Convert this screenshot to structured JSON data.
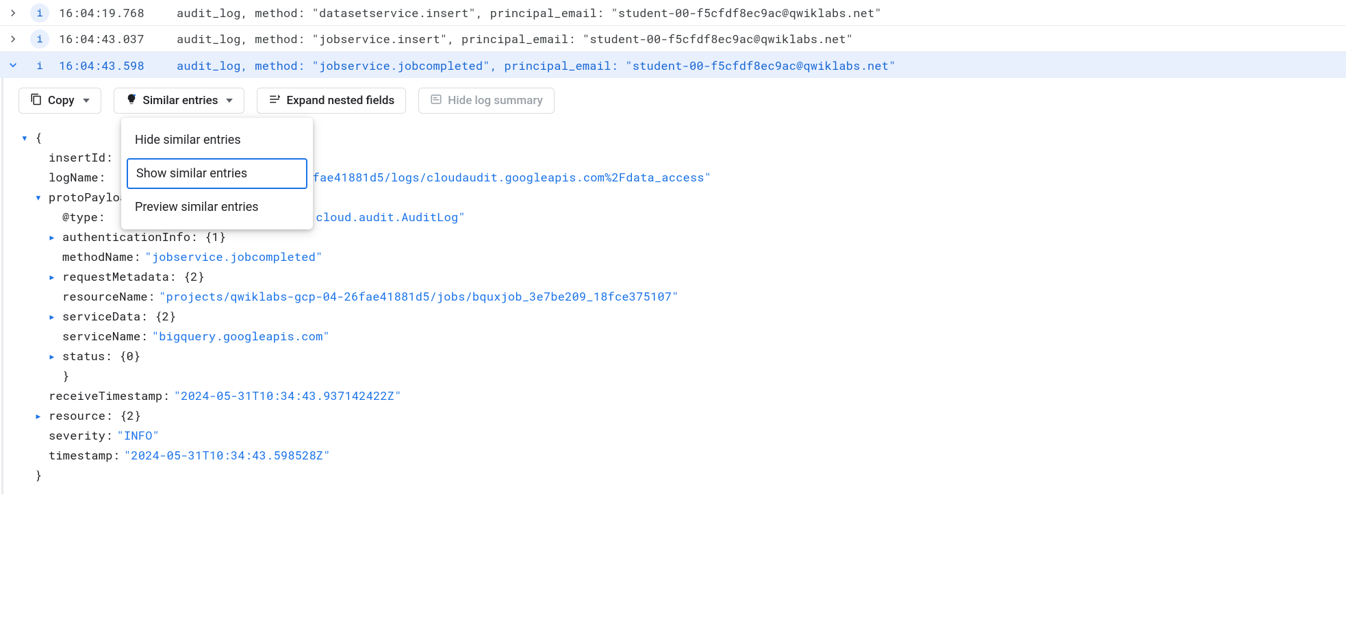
{
  "rows": [
    {
      "ts": "16:04:19.768",
      "summary_prefix": "audit_log, method: ",
      "method": "\"datasetservice.insert\"",
      "summary_mid": ", principal_email: ",
      "email": "\"student-00-f5cfdf8ec9ac@qwiklabs.net\""
    },
    {
      "ts": "16:04:43.037",
      "summary_prefix": "audit_log, method: ",
      "method": "\"jobservice.insert\"",
      "summary_mid": ", principal_email: ",
      "email": "\"student-00-f5cfdf8ec9ac@qwiklabs.net\""
    },
    {
      "ts": "16:04:43.598",
      "summary_prefix": "audit_log, method: ",
      "method": "\"jobservice.jobcompleted\"",
      "summary_mid": ", principal_email: ",
      "email": "\"student-00-f5cfdf8ec9ac@qwiklabs.net\""
    }
  ],
  "toolbar": {
    "copy": "Copy",
    "similar": "Similar entries",
    "expand": "Expand nested fields",
    "hide_summary": "Hide log summary"
  },
  "menu": {
    "hide": "Hide similar entries",
    "show": "Show similar entries",
    "preview": "Preview similar entries"
  },
  "entry": {
    "insertId_key": "insertId:",
    "logName_key": "logName:",
    "logName_tail": "6fae41881d5/logs/cloudaudit.googleapis.com%2Fdata_access\"",
    "protoPayload_key": "protoPayload:",
    "atType_key": "@type:",
    "atType_tail": "cloud.audit.AuditLog\"",
    "authInfo_label": "authenticationInfo: {1}",
    "methodName_key": "methodName:",
    "methodName_val": "\"jobservice.jobcompleted\"",
    "reqMeta_label": "requestMetadata: {2}",
    "resourceName_key": "resourceName:",
    "resourceName_val": "\"projects/qwiklabs-gcp-04-26fae41881d5/jobs/bquxjob_3e7be209_18fce375107\"",
    "serviceData_label": "serviceData: {2}",
    "serviceName_key": "serviceName:",
    "serviceName_val": "\"bigquery.googleapis.com\"",
    "status_label": "status: {0}",
    "receiveTs_key": "receiveTimestamp:",
    "receiveTs_val": "\"2024-05-31T10:34:43.937142422Z\"",
    "resource_label": "resource: {2}",
    "severity_key": "severity:",
    "severity_val": "\"INFO\"",
    "timestamp_key": "timestamp:",
    "timestamp_val": "\"2024-05-31T10:34:43.598528Z\""
  }
}
